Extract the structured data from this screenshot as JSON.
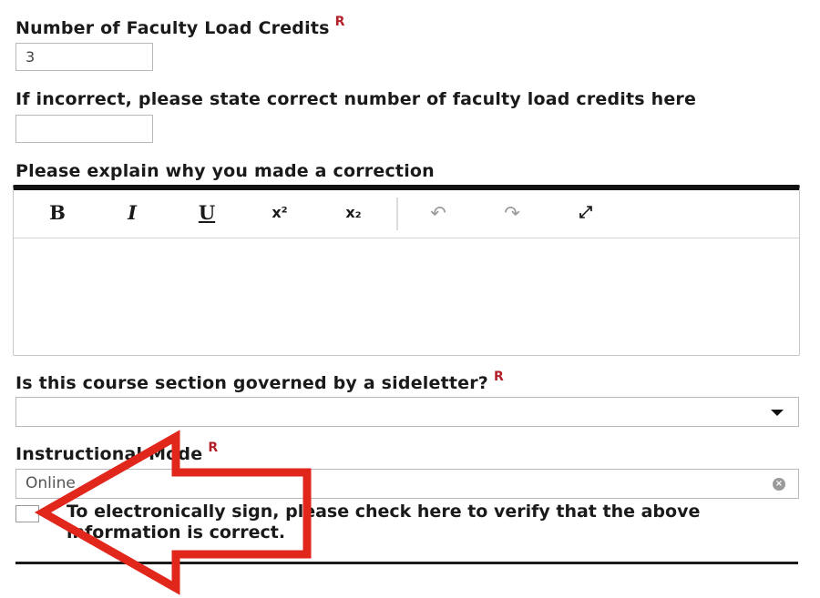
{
  "form": {
    "load_credits": {
      "label": "Number of Faculty Load Credits",
      "required_marker": "R",
      "value": "3"
    },
    "correct_credits": {
      "label": "If incorrect, please state correct number of faculty load credits here",
      "value": ""
    },
    "explanation": {
      "label": "Please explain why you made a correction",
      "toolbar": {
        "bold": "B",
        "italic": "I",
        "underline": "U",
        "superscript": "x²",
        "subscript": "x₂",
        "undo": "↶",
        "redo": "↷",
        "fullscreen": "⤢"
      },
      "value": ""
    },
    "sideletter": {
      "label": "Is this course section governed by a sideletter?",
      "required_marker": "R",
      "selected": ""
    },
    "instructional_mode": {
      "label": "Instructional Mode",
      "required_marker": "R",
      "value": "Online"
    },
    "signature": {
      "checked": false,
      "text": "To electronically sign, please check here to verify that the above information is correct."
    }
  },
  "annotation": {
    "type": "arrow",
    "color": "#e1261c",
    "points_to": "signature checkbox"
  }
}
